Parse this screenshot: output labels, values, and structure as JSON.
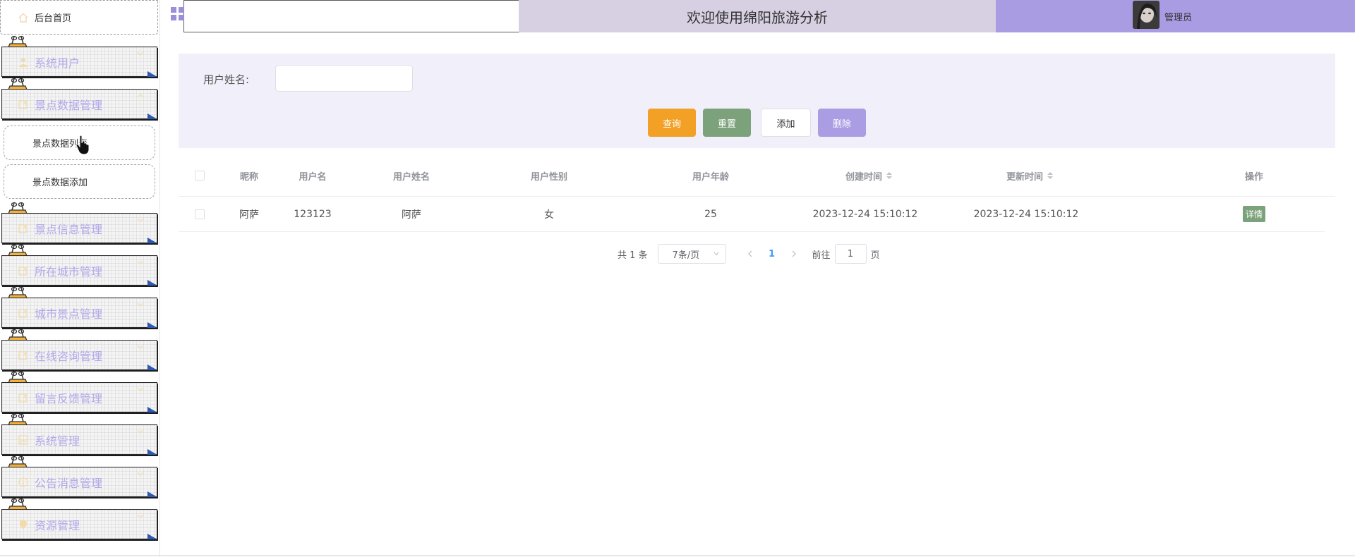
{
  "sidebar": {
    "home": {
      "label": "后台首页",
      "icon": "home-icon"
    },
    "menus": [
      {
        "label": "系统用户",
        "icon": "user-icon"
      },
      {
        "label": "景点数据管理",
        "icon": "edit-icon"
      },
      {
        "label": "景点信息管理",
        "icon": "edit-icon"
      },
      {
        "label": "所在城市管理",
        "icon": "edit-icon"
      },
      {
        "label": "城市景点管理",
        "icon": "edit-icon"
      },
      {
        "label": "在线咨询管理",
        "icon": "edit-icon"
      },
      {
        "label": "留言反馈管理",
        "icon": "edit-icon"
      },
      {
        "label": "系统管理",
        "icon": "image-icon"
      },
      {
        "label": "公告消息管理",
        "icon": "info-icon"
      },
      {
        "label": "资源管理",
        "icon": "location-icon"
      }
    ],
    "submenu": [
      {
        "label": "景点数据列表"
      },
      {
        "label": "景点数据添加"
      }
    ]
  },
  "header": {
    "title": "欢迎使用绵阳旅游分析",
    "user_name": "管理员"
  },
  "search": {
    "label": "用户姓名:",
    "value": "",
    "placeholder": "",
    "buttons": {
      "query": "查询",
      "reset": "重置",
      "add": "添加",
      "delete": "删除"
    }
  },
  "table": {
    "columns": {
      "nickname": "昵称",
      "username": "用户名",
      "realname": "用户姓名",
      "gender": "用户性别",
      "age": "用户年龄",
      "created": "创建时间",
      "updated": "更新时间",
      "actions": "操作"
    },
    "rows": [
      {
        "nickname": "阿萨",
        "username": "123123",
        "realname": "阿萨",
        "gender": "女",
        "age": "25",
        "created": "2023-12-24 15:10:12",
        "updated": "2023-12-24 15:10:12",
        "action": "详情"
      }
    ]
  },
  "pagination": {
    "total": "共 1 条",
    "page_size": "7条/页",
    "current_page": "1",
    "goto_prefix": "前往",
    "goto_value": "1",
    "goto_suffix": "页"
  },
  "colors": {
    "accent_purple": "#a99ce3",
    "welcome_bg": "#d7d0e2",
    "query_orange": "#f2a126",
    "reset_green": "#7ca27b",
    "delete_purple": "#ab9de3",
    "search_panel_bg": "#f1eff9",
    "menu_label": "#b4a7ea"
  }
}
